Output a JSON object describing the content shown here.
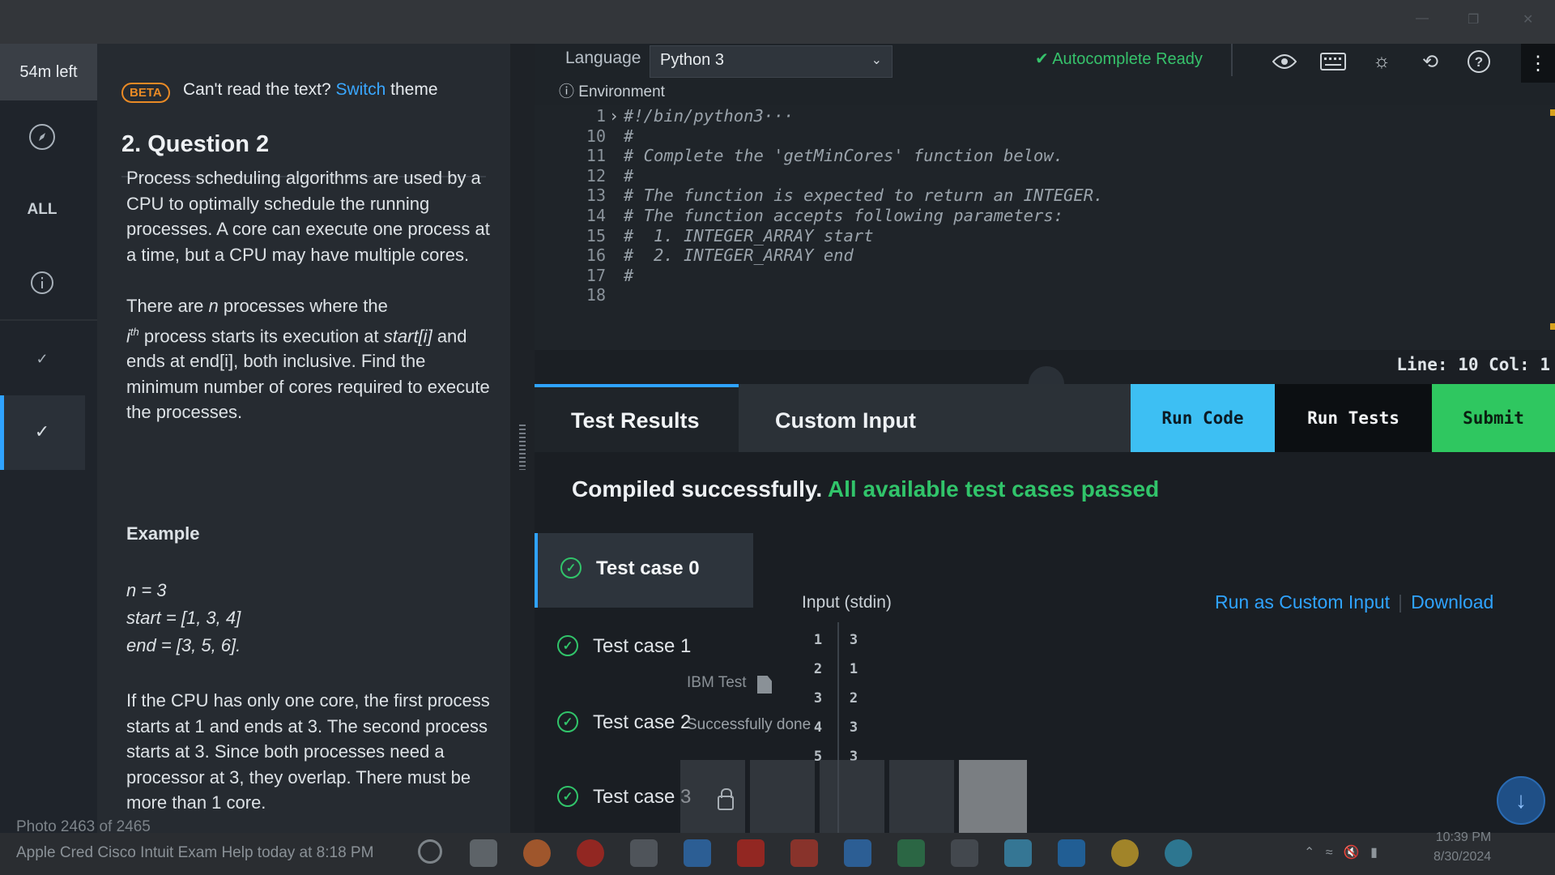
{
  "timer": "54m left",
  "rail": {
    "all_label": "ALL"
  },
  "question": {
    "beta": "BETA",
    "cant_read": "Can't read the text?",
    "switch_link": "Switch",
    "theme_word": "theme",
    "title": "2. Question 2",
    "p1": "Process scheduling algorithms are used by a CPU to optimally schedule the running processes. A core can execute one process at a time, but a CPU may have multiple cores.",
    "p2_a": "There are",
    "p2_n": "n",
    "p2_b": "processes where the",
    "p2_i": "i",
    "p2_th": "th",
    "p2_c": "process starts its execution at",
    "p2_start": "start[i]",
    "p2_d": "and ends at end[i], both inclusive. Find the minimum number of cores required to execute the processes.",
    "example_heading": "Example",
    "ex_n": "n = 3",
    "ex_start": "start = [1, 3, 4]",
    "ex_end": "end = [3, 5, 6].",
    "p3": "If the CPU has only one core, the first process starts at 1 and ends at 3. The second process starts at 3. Since both processes need a processor at 3, they overlap. There must be more than 1 core."
  },
  "editor": {
    "language_label": "Language",
    "language_value": "Python 3",
    "environment": "Environment",
    "autocomplete": "Autocomplete Ready",
    "icons": [
      "eye-icon",
      "keyboard-icon",
      "sun-icon",
      "history-icon",
      "help-icon",
      "more-vertical-icon"
    ],
    "lines": [
      {
        "num": "1",
        "text": "#!/bin/python3···"
      },
      {
        "num": "10",
        "text": "#"
      },
      {
        "num": "11",
        "text": "# Complete the 'getMinCores' function below."
      },
      {
        "num": "12",
        "text": "#"
      },
      {
        "num": "13",
        "text": "# The function is expected to return an INTEGER."
      },
      {
        "num": "14",
        "text": "# The function accepts following parameters:"
      },
      {
        "num": "15",
        "text": "#  1. INTEGER_ARRAY start"
      },
      {
        "num": "16",
        "text": "#  2. INTEGER_ARRAY end"
      },
      {
        "num": "17",
        "text": "#"
      },
      {
        "num": "18",
        "text": ""
      }
    ],
    "status": "Line: 10 Col: 1"
  },
  "tabs": {
    "results": "Test Results",
    "custom": "Custom Input",
    "run_code": "Run Code",
    "run_tests": "Run Tests",
    "submit": "Submit"
  },
  "results": {
    "compiled": "Compiled successfully.",
    "passed": "All available test cases passed",
    "cases": [
      "Test case 0",
      "Test case 1",
      "Test case 2",
      "Test case 3"
    ],
    "stdin_label": "Input (stdin)",
    "run_as_custom": "Run as Custom Input",
    "download": "Download",
    "stdin_rows": [
      {
        "n": "1",
        "v": "3"
      },
      {
        "n": "2",
        "v": "1"
      },
      {
        "n": "3",
        "v": "2"
      },
      {
        "n": "4",
        "v": "3"
      },
      {
        "n": "5",
        "v": "3"
      }
    ]
  },
  "overlay": {
    "ibm_test": "IBM Test",
    "success": "Successfully done",
    "photo_caption": "Photo 2463 of 2465",
    "photo_sub": "Apple Cred Cisco Intuit Exam Help   today at 8:18 PM",
    "tray_time": "10:39 PM",
    "tray_date": "8/30/2024"
  },
  "colors": {
    "accent": "#2fa3ff",
    "success": "#31c46a",
    "run_code": "#3dbff3",
    "submit": "#2fc760",
    "beta": "#e98a25"
  }
}
